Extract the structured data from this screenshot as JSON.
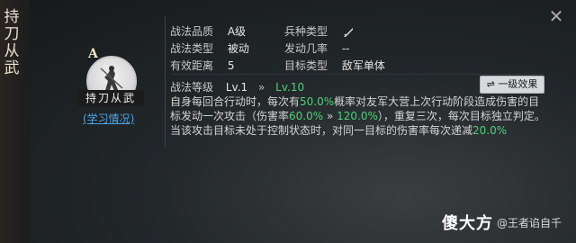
{
  "title_vertical": [
    "持",
    "刀",
    "从",
    "武"
  ],
  "close_icon": "✕",
  "portrait": {
    "grade": "A",
    "name": "持刀从武",
    "study_link": "(学习情况)"
  },
  "info": {
    "quality_label": "战法品质",
    "quality_value": "A级",
    "type_label": "战法类型",
    "type_value": "被动",
    "range_label": "有效距离",
    "range_value": "5",
    "unit_label": "兵种类型",
    "trigger_label": "发动几率",
    "trigger_value": "--",
    "target_label": "目标类型",
    "target_value": "敌军单体"
  },
  "level": {
    "label": "战法等级",
    "from": "Lv.1",
    "arrow": "»",
    "to": "Lv.10"
  },
  "effect_button": "⇌ 一级效果",
  "description": {
    "p1": "自身每回合行动时，每次有",
    "pct1": "50.0%",
    "p2": "概率对友军大营上次行动阶段造成伤害的目标发动一次攻击（伤害率",
    "pct2": "60.0%",
    "p3": " » ",
    "pct3": "120.0%",
    "p4": "），重复三次，每次目标独立判定。当该攻击目标未处于控制状态时，对同一目标的伤害率每次递减",
    "pct4": "20.0%"
  },
  "watermark": {
    "mark": "傻大方",
    "account": "@王者谄自千"
  }
}
